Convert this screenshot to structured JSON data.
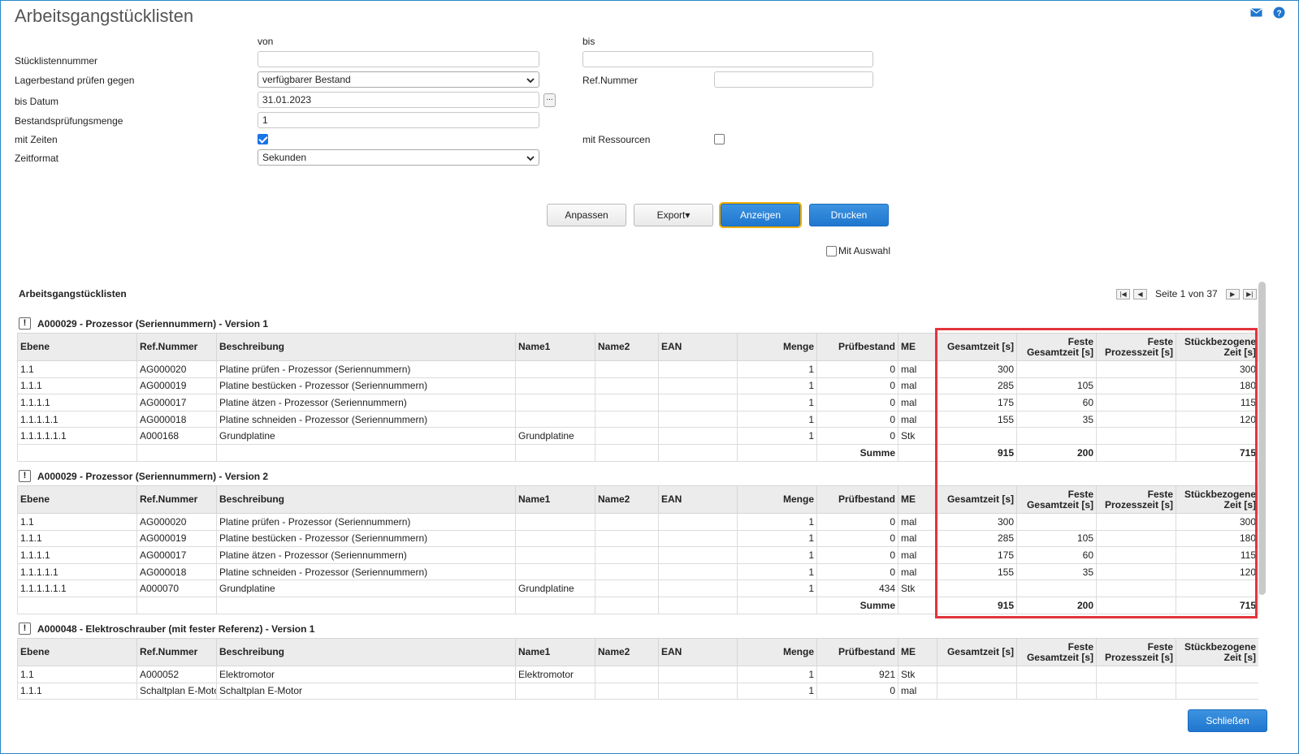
{
  "page": {
    "title": "Arbeitsgangstücklisten"
  },
  "form": {
    "von": "von",
    "bis": "bis",
    "stueckliste_label": "Stücklistennummer",
    "stueckliste_von": "",
    "stueckliste_bis": "",
    "lager_label": "Lagerbestand prüfen gegen",
    "lager_value": "verfügbarer Bestand",
    "refnr_label": "Ref.Nummer",
    "refnr_value": "",
    "datum_label": "bis Datum",
    "datum_value": "31.01.2023",
    "datum_picker": "...",
    "menge_label": "Bestandsprüfungsmenge",
    "menge_value": "1",
    "zeiten_label": "mit Zeiten",
    "zeiten_checked": true,
    "ressourcen_label": "mit Ressourcen",
    "ressourcen_checked": false,
    "zeitformat_label": "Zeitformat",
    "zeitformat_value": "Sekunden"
  },
  "buttons": {
    "anpassen": "Anpassen",
    "export": "Export▾",
    "anzeigen": "Anzeigen",
    "drucken": "Drucken",
    "mit_auswahl": "Mit Auswahl",
    "schliessen": "Schließen"
  },
  "results": {
    "title": "Arbeitsgangstücklisten",
    "pager": "Seite 1 von 37"
  },
  "headers": {
    "ebene": "Ebene",
    "refnr": "Ref.Nummer",
    "beschreibung": "Beschreibung",
    "name1": "Name1",
    "name2": "Name2",
    "ean": "EAN",
    "menge": "Menge",
    "pruefbestand": "Prüfbestand",
    "me": "ME",
    "gesamtzeit": "Gesamtzeit [s]",
    "feste_gesamt": "Feste Gesamtzeit [s]",
    "feste_prozess": "Feste Prozesszeit [s]",
    "stueck": "Stückbezogene Zeit [s]"
  },
  "groups": [
    {
      "title": "A000029 - Prozessor (Seriennummern) - Version 1",
      "rows": [
        [
          "1.1",
          "AG000020",
          "Platine prüfen - Prozessor (Seriennummern)",
          "",
          "",
          "",
          "1",
          "0",
          "mal",
          "300",
          "",
          "",
          "300"
        ],
        [
          "1.1.1",
          "AG000019",
          "Platine bestücken - Prozessor (Seriennummern)",
          "",
          "",
          "",
          "1",
          "0",
          "mal",
          "285",
          "105",
          "",
          "180"
        ],
        [
          "1.1.1.1",
          "AG000017",
          "Platine ätzen - Prozessor (Seriennummern)",
          "",
          "",
          "",
          "1",
          "0",
          "mal",
          "175",
          "60",
          "",
          "115"
        ],
        [
          "1.1.1.1.1",
          "AG000018",
          "Platine schneiden - Prozessor (Seriennummern)",
          "",
          "",
          "",
          "1",
          "0",
          "mal",
          "155",
          "35",
          "",
          "120"
        ],
        [
          "1.1.1.1.1.1",
          "A000168",
          "Grundplatine",
          "Grundplatine",
          "",
          "",
          "1",
          "0",
          "Stk",
          "",
          "",
          "",
          ""
        ]
      ],
      "sum": {
        "label": "Summe",
        "gesamt": "915",
        "feste": "200",
        "prozess": "",
        "stueck": "715"
      }
    },
    {
      "title": "A000029 - Prozessor (Seriennummern) - Version 2",
      "rows": [
        [
          "1.1",
          "AG000020",
          "Platine prüfen - Prozessor (Seriennummern)",
          "",
          "",
          "",
          "1",
          "0",
          "mal",
          "300",
          "",
          "",
          "300"
        ],
        [
          "1.1.1",
          "AG000019",
          "Platine bestücken - Prozessor (Seriennummern)",
          "",
          "",
          "",
          "1",
          "0",
          "mal",
          "285",
          "105",
          "",
          "180"
        ],
        [
          "1.1.1.1",
          "AG000017",
          "Platine ätzen - Prozessor (Seriennummern)",
          "",
          "",
          "",
          "1",
          "0",
          "mal",
          "175",
          "60",
          "",
          "115"
        ],
        [
          "1.1.1.1.1",
          "AG000018",
          "Platine schneiden - Prozessor (Seriennummern)",
          "",
          "",
          "",
          "1",
          "0",
          "mal",
          "155",
          "35",
          "",
          "120"
        ],
        [
          "1.1.1.1.1.1",
          "A000070",
          "Grundplatine",
          "Grundplatine",
          "",
          "",
          "1",
          "434",
          "Stk",
          "",
          "",
          "",
          ""
        ]
      ],
      "sum": {
        "label": "Summe",
        "gesamt": "915",
        "feste": "200",
        "prozess": "",
        "stueck": "715"
      }
    },
    {
      "title": "A000048 - Elektroschrauber (mit fester Referenz) - Version 1",
      "rows": [
        [
          "1.1",
          "A000052",
          "Elektromotor",
          "Elektromotor",
          "",
          "",
          "1",
          "921",
          "Stk",
          "",
          "",
          "",
          ""
        ],
        [
          "1.1.1",
          "Schaltplan E-Motor",
          "Schaltplan E-Motor",
          "",
          "",
          "",
          "1",
          "0",
          "mal",
          "",
          "",
          "",
          ""
        ]
      ]
    }
  ],
  "colors": {
    "accent": "#1f77cf",
    "highlight": "#e2343c",
    "red_ref": "#e0282e"
  }
}
